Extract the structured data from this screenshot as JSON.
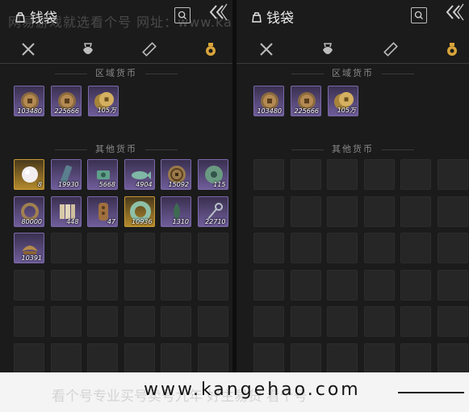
{
  "panels": [
    {
      "title": "钱袋",
      "tabs": [
        "weapons-tab",
        "bag-tab",
        "scroll-tab",
        "currency-tab"
      ],
      "regional_title": "区域货币",
      "other_title": "其他货币",
      "regional": [
        {
          "qty": "103480",
          "rarity": "purple",
          "icon": "copper-coin-icon"
        },
        {
          "qty": "225666",
          "rarity": "purple",
          "icon": "copper-coin-icon"
        },
        {
          "qty": "105万",
          "rarity": "purple",
          "icon": "gold-coin-icon"
        }
      ],
      "other": [
        {
          "qty": "8",
          "rarity": "gold",
          "icon": "pearl-icon"
        },
        {
          "qty": "19930",
          "rarity": "purple",
          "icon": "scroll-icon"
        },
        {
          "qty": "5668",
          "rarity": "purple",
          "icon": "jade-icon"
        },
        {
          "qty": "4904",
          "rarity": "purple",
          "icon": "fish-icon"
        },
        {
          "qty": "15092",
          "rarity": "purple",
          "icon": "round-coin-icon"
        },
        {
          "qty": "115",
          "rarity": "purple",
          "icon": "jade-disc-icon"
        },
        {
          "qty": "80000",
          "rarity": "purple",
          "icon": "bracelet-icon"
        },
        {
          "qty": "448",
          "rarity": "purple",
          "icon": "tablets-icon"
        },
        {
          "qty": "47",
          "rarity": "purple",
          "icon": "bead-string-icon"
        },
        {
          "qty": "10936",
          "rarity": "gold",
          "icon": "jade-ring-icon"
        },
        {
          "qty": "1310",
          "rarity": "purple",
          "icon": "leaf-icon"
        },
        {
          "qty": "22710",
          "rarity": "purple",
          "icon": "key-icon"
        },
        {
          "qty": "10391",
          "rarity": "purple",
          "icon": "ingot-icon"
        }
      ]
    },
    {
      "title": "钱袋",
      "regional_title": "区域货币",
      "other_title": "其他货币",
      "regional": [
        {
          "qty": "103480",
          "rarity": "purple",
          "icon": "copper-coin-icon"
        },
        {
          "qty": "225666",
          "rarity": "purple",
          "icon": "copper-coin-icon"
        },
        {
          "qty": "105万",
          "rarity": "purple",
          "icon": "gold-coin-icon"
        }
      ]
    }
  ],
  "watermark": {
    "top_text": "网易游戏就选看个号  网址：www.kangehao.com",
    "url": "www.kangehao.com",
    "bottom_text": "看个号专业买号卖号九年  好主易货  看个号"
  },
  "colors": {
    "accent": "#d9a53a",
    "purple": "#6f5d9a",
    "gold": "#b38a2c"
  }
}
